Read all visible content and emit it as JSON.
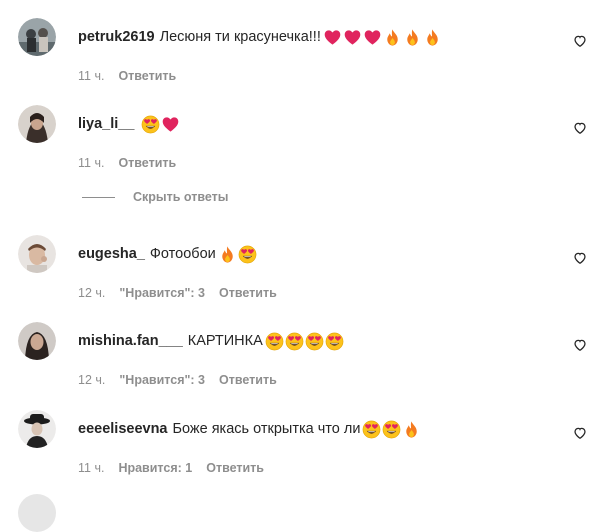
{
  "icons": {
    "like": "heart-outline-icon",
    "heart_emoji": "red-heart-icon",
    "fire_emoji": "fire-icon",
    "heart_eyes_emoji": "heart-eyes-icon"
  },
  "colors": {
    "text": "#262626",
    "secondary": "#8e8e8e",
    "heart": "#e0245e",
    "fire": "#f47b20"
  },
  "comments": [
    {
      "username": "petruk2619",
      "text": "Лесюня ти красунечка!!!",
      "emojis": [
        "heart",
        "heart",
        "heart",
        "fire",
        "fire",
        "fire"
      ],
      "time": "11 ч.",
      "likes": "",
      "reply": "Ответить"
    },
    {
      "username": "liya_li__",
      "text": "",
      "emojis": [
        "heart_eyes",
        "heart"
      ],
      "time": "11 ч.",
      "likes": "",
      "reply": "Ответить"
    },
    {
      "username": "eugesha_",
      "text": "Фотообои",
      "emojis": [
        "fire",
        "heart_eyes"
      ],
      "time": "12 ч.",
      "likes": "\"Нравится\": 3",
      "reply": "Ответить"
    },
    {
      "username": "mishina.fan___",
      "text": "КАРТИНКА",
      "emojis": [
        "heart_eyes",
        "heart_eyes",
        "heart_eyes",
        "heart_eyes"
      ],
      "time": "12 ч.",
      "likes": "\"Нравится\": 3",
      "reply": "Ответить"
    },
    {
      "username": "eeeeliseevna",
      "text": "Боже якась открытка что ли",
      "emojis": [
        "heart_eyes",
        "heart_eyes",
        "fire"
      ],
      "time": "11 ч.",
      "likes": "Нравится: 1",
      "reply": "Ответить"
    }
  ],
  "hide_replies_label": "Скрыть ответы"
}
